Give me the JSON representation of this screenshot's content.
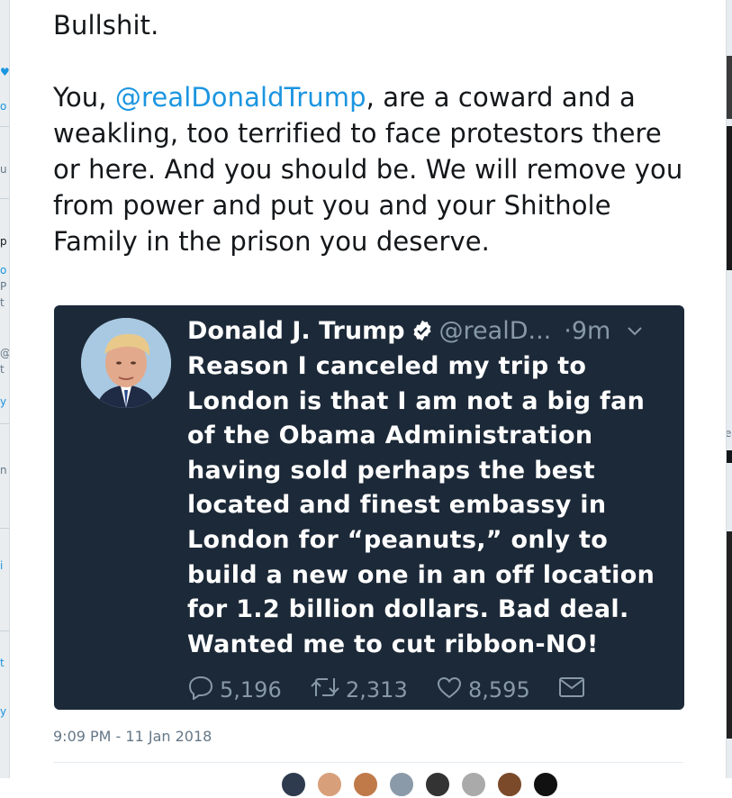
{
  "tweet": {
    "line1": "Bullshit.",
    "before_mention": "You, ",
    "mention": "@realDonaldTrump",
    "after_mention": ", are a coward and a weakling, too terrified to face protestors there or here. And you should be. We will remove you from power and put you and your Shithole Family in the prison you deserve.",
    "timestamp": "9:09 PM - 11 Jan 2018"
  },
  "quoted_tweet": {
    "name": "Donald J. Trump",
    "handle": "@realD...",
    "time": "·9m",
    "text": "Reason I canceled my trip to London is that I am not a big fan of the Obama Administration having sold perhaps the best located and finest embassy in London for “peanuts,” only to build a new one in an off location for 1.2 billion dollars. Bad deal. Wanted me to cut ribbon-NO!",
    "replies": "5,196",
    "retweets": "2,313",
    "likes": "8,595",
    "icons": {
      "verified": "verified-badge-icon",
      "caret": "chevron-down-icon",
      "reply": "reply-icon",
      "retweet": "retweet-icon",
      "like": "heart-icon",
      "message": "envelope-icon"
    }
  },
  "colors": {
    "mention": "#1b95e0",
    "quote_bg": "#1c2938",
    "muted": "#8899a6"
  }
}
